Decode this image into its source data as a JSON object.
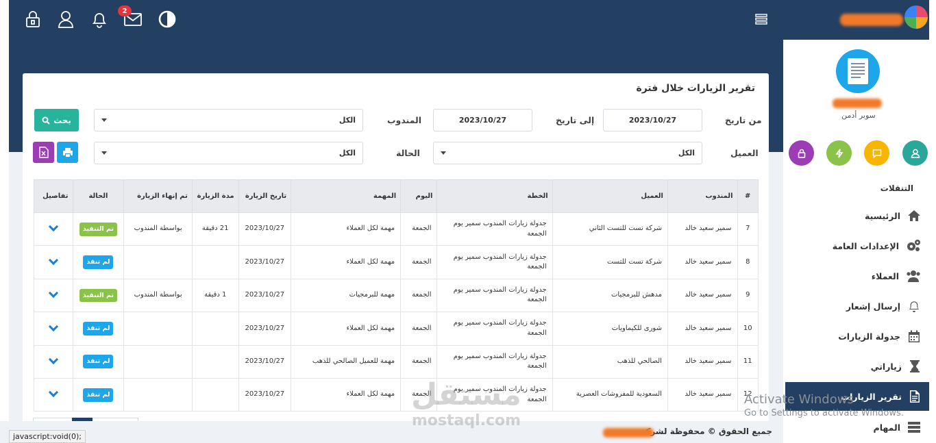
{
  "topbar": {
    "notification_count": "2",
    "icons": [
      "lock-icon",
      "user-icon",
      "bell-icon",
      "mail-icon",
      "contrast-icon",
      "menu-icon"
    ]
  },
  "sidebar": {
    "user_role": "سوبر أدمن",
    "nav_title": "التنقلات",
    "items": [
      {
        "label": "الرئيسية",
        "icon": "home-icon"
      },
      {
        "label": "الإعدادات العامة",
        "icon": "gears-icon"
      },
      {
        "label": "العملاء",
        "icon": "users-icon"
      },
      {
        "label": "إرسال إشعار",
        "icon": "bell-icon"
      },
      {
        "label": "جدولة الزيارات",
        "icon": "calendar-icon"
      },
      {
        "label": "زياراتي",
        "icon": "hourglass-icon"
      },
      {
        "label": "تقرير الزيارات",
        "icon": "report-icon",
        "active": true
      },
      {
        "label": "المهام",
        "icon": "tasks-icon"
      }
    ],
    "quick_colors": [
      "#2aa79a",
      "#f7b500",
      "#8bc34a",
      "#9c3db5"
    ]
  },
  "report": {
    "title": "تقرير الزيارات خلال فترة",
    "from_label": "من تاريخ",
    "from_value": "2023/10/27",
    "to_label": "إلى تاريخ",
    "to_value": "2023/10/27",
    "rep_label": "المندوب",
    "rep_value": "الكل",
    "client_label": "العميل",
    "client_value": "الكل",
    "status_label": "الحالة",
    "status_value": "الكل",
    "search_label": "بحث"
  },
  "table": {
    "headers": {
      "num": "#",
      "rep": "المندوب",
      "client": "العميل",
      "plan": "الخطة",
      "day": "اليوم",
      "task": "المهمة",
      "date": "تاريخ الزيارة",
      "duration": "مدة الزيارة",
      "ended_by": "تم إنهاء الزيارة",
      "status": "الحالة",
      "details": "تفاصيل"
    },
    "rows": [
      {
        "num": "7",
        "rep": "سمير سعيد خالد",
        "client": "شركة تست للتست الثاني",
        "plan": "جدولة زيارات المندوب سمير يوم الجمعة",
        "day": "الجمعة",
        "task": "مهمة لكل العملاء",
        "date": "2023/10/27",
        "duration": "21 دقيقة",
        "ended_by": "بواسطة المندوب",
        "status": "تم التنفيذ",
        "done": true
      },
      {
        "num": "8",
        "rep": "سمير سعيد خالد",
        "client": "شركة تست للتست",
        "plan": "جدولة زيارات المندوب سمير يوم الجمعة",
        "day": "الجمعة",
        "task": "مهمة لكل العملاء",
        "date": "2023/10/27",
        "duration": "",
        "ended_by": "",
        "status": "لم تنفذ",
        "done": false
      },
      {
        "num": "9",
        "rep": "سمير سعيد خالد",
        "client": "مدهش للبرمجيات",
        "plan": "جدولة زيارات المندوب سمير يوم الجمعة",
        "day": "الجمعة",
        "task": "مهمة للبرمجيات",
        "date": "2023/10/27",
        "duration": "1 دقيقة",
        "ended_by": "بواسطة المندوب",
        "status": "تم التنفيذ",
        "done": true
      },
      {
        "num": "10",
        "rep": "سمير سعيد خالد",
        "client": "شورى للكيماويات",
        "plan": "جدولة زيارات المندوب سمير يوم الجمعة",
        "day": "الجمعة",
        "task": "مهمة لكل العملاء",
        "date": "2023/10/27",
        "duration": "",
        "ended_by": "",
        "status": "لم تنفذ",
        "done": false
      },
      {
        "num": "11",
        "rep": "سمير سعيد خالد",
        "client": "الصالحي للذهب",
        "plan": "جدولة زيارات المندوب سمير يوم الجمعة",
        "day": "الجمعة",
        "task": "مهمة للعميل الصالحي للذهب",
        "date": "2023/10/27",
        "duration": "",
        "ended_by": "",
        "status": "لم تنفذ",
        "done": false
      },
      {
        "num": "12",
        "rep": "سمير سعيد خالد",
        "client": "السعودية للمفروشات العصرية",
        "plan": "جدولة زيارات المندوب سمير يوم الجمعة",
        "day": "الجمعة",
        "task": "مهمة لكل العملاء",
        "date": "2023/10/27",
        "duration": "",
        "ended_by": "",
        "status": "لم تنفذ",
        "done": false
      }
    ]
  },
  "footer": {
    "text": "جميع الحقوق © محفوظة لشركة"
  },
  "statusbar": {
    "url": "javascript:void(0);"
  },
  "overlay": {
    "activate_title": "Activate Windows",
    "activate_sub": "Go to Settings to activate Windows.",
    "watermark_ar": "مستقل",
    "watermark_en": "mostaql.com"
  }
}
